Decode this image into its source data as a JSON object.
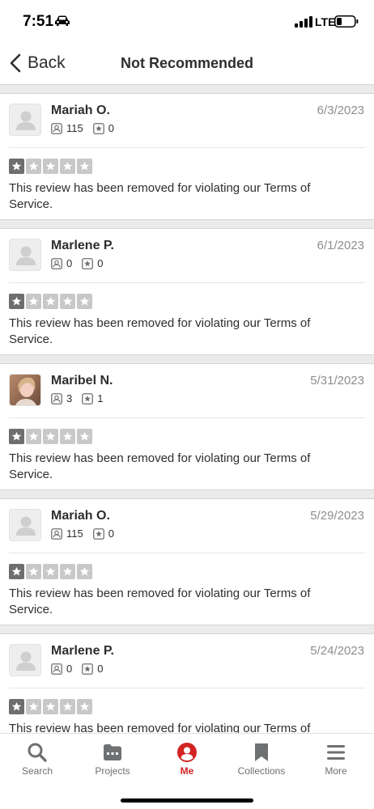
{
  "status_bar": {
    "time": "7:51",
    "network": "LTE"
  },
  "nav": {
    "back_label": "Back",
    "title": "Not Recommended"
  },
  "reviews": [
    {
      "name": "Mariah O.",
      "date": "6/3/2023",
      "friends": "115",
      "reviews": "0",
      "rating": 1,
      "text": "This review has been removed for violating our Terms of Service.",
      "avatar": "default"
    },
    {
      "name": "Marlene P.",
      "date": "6/1/2023",
      "friends": "0",
      "reviews": "0",
      "rating": 1,
      "text": "This review has been removed for violating our Terms of Service.",
      "avatar": "default"
    },
    {
      "name": "Maribel N.",
      "date": "5/31/2023",
      "friends": "3",
      "reviews": "1",
      "rating": 1,
      "text": "This review has been removed for violating our Terms of Service.",
      "avatar": "photo"
    },
    {
      "name": "Mariah O.",
      "date": "5/29/2023",
      "friends": "115",
      "reviews": "0",
      "rating": 1,
      "text": "This review has been removed for violating our Terms of Service.",
      "avatar": "default"
    },
    {
      "name": "Marlene P.",
      "date": "5/24/2023",
      "friends": "0",
      "reviews": "0",
      "rating": 1,
      "text": "This review has been removed for violating our Terms of Service.",
      "avatar": "default"
    }
  ],
  "tabs": [
    {
      "label": "Search",
      "icon": "search-icon",
      "active": false
    },
    {
      "label": "Projects",
      "icon": "projects-icon",
      "active": false
    },
    {
      "label": "Me",
      "icon": "me-icon",
      "active": true
    },
    {
      "label": "Collections",
      "icon": "bookmark-icon",
      "active": false
    },
    {
      "label": "More",
      "icon": "menu-icon",
      "active": false
    }
  ],
  "colors": {
    "accent": "#d32323",
    "star_filled": "#6e6e6e",
    "star_empty": "#c8c8c8"
  }
}
